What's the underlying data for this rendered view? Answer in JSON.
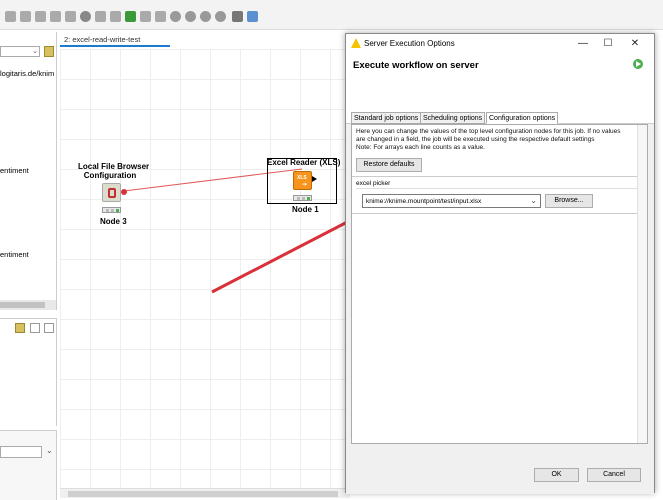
{
  "editor": {
    "tab_label": "2: excel-read-write-test"
  },
  "left_panel": {
    "url_fragment": "logitaris.de/knim",
    "item_1": "entiment",
    "item_2": "entiment"
  },
  "nodes": {
    "local_file_browser": {
      "title_line1": "Local File Browser",
      "title_line2": "Configuration",
      "label": "Node 3"
    },
    "excel_reader": {
      "title": "Excel Reader (XLS)",
      "label": "Node 1",
      "icon_text": "XLS"
    }
  },
  "dialog": {
    "title": "Server Execution Options",
    "heading": "Execute workflow on server",
    "tabs": [
      "Standard job options",
      "Scheduling options",
      "Configuration options"
    ],
    "active_tab": "Configuration options",
    "description_line1": "Here you can change the values of the top level configuration nodes for this job. If no values",
    "description_line2": "are changed in a field, the job will be executed using the respective default settings",
    "description_line3": "Note: For arrays each line counts as a value.",
    "restore_defaults": "Restore defaults",
    "picker_label": "excel picker",
    "picker_value": "knime://knime.mountpoint/test/input.xlsx",
    "browse": "Browse...",
    "ok": "OK",
    "cancel": "Cancel",
    "minimize": "—",
    "maximize": "☐",
    "close": "✕"
  },
  "colors": {
    "annotation_arrow": "#d9303a",
    "node_orange": "#f7941d",
    "run_green": "#4caf50",
    "tab_accent": "#1b7bd3"
  }
}
